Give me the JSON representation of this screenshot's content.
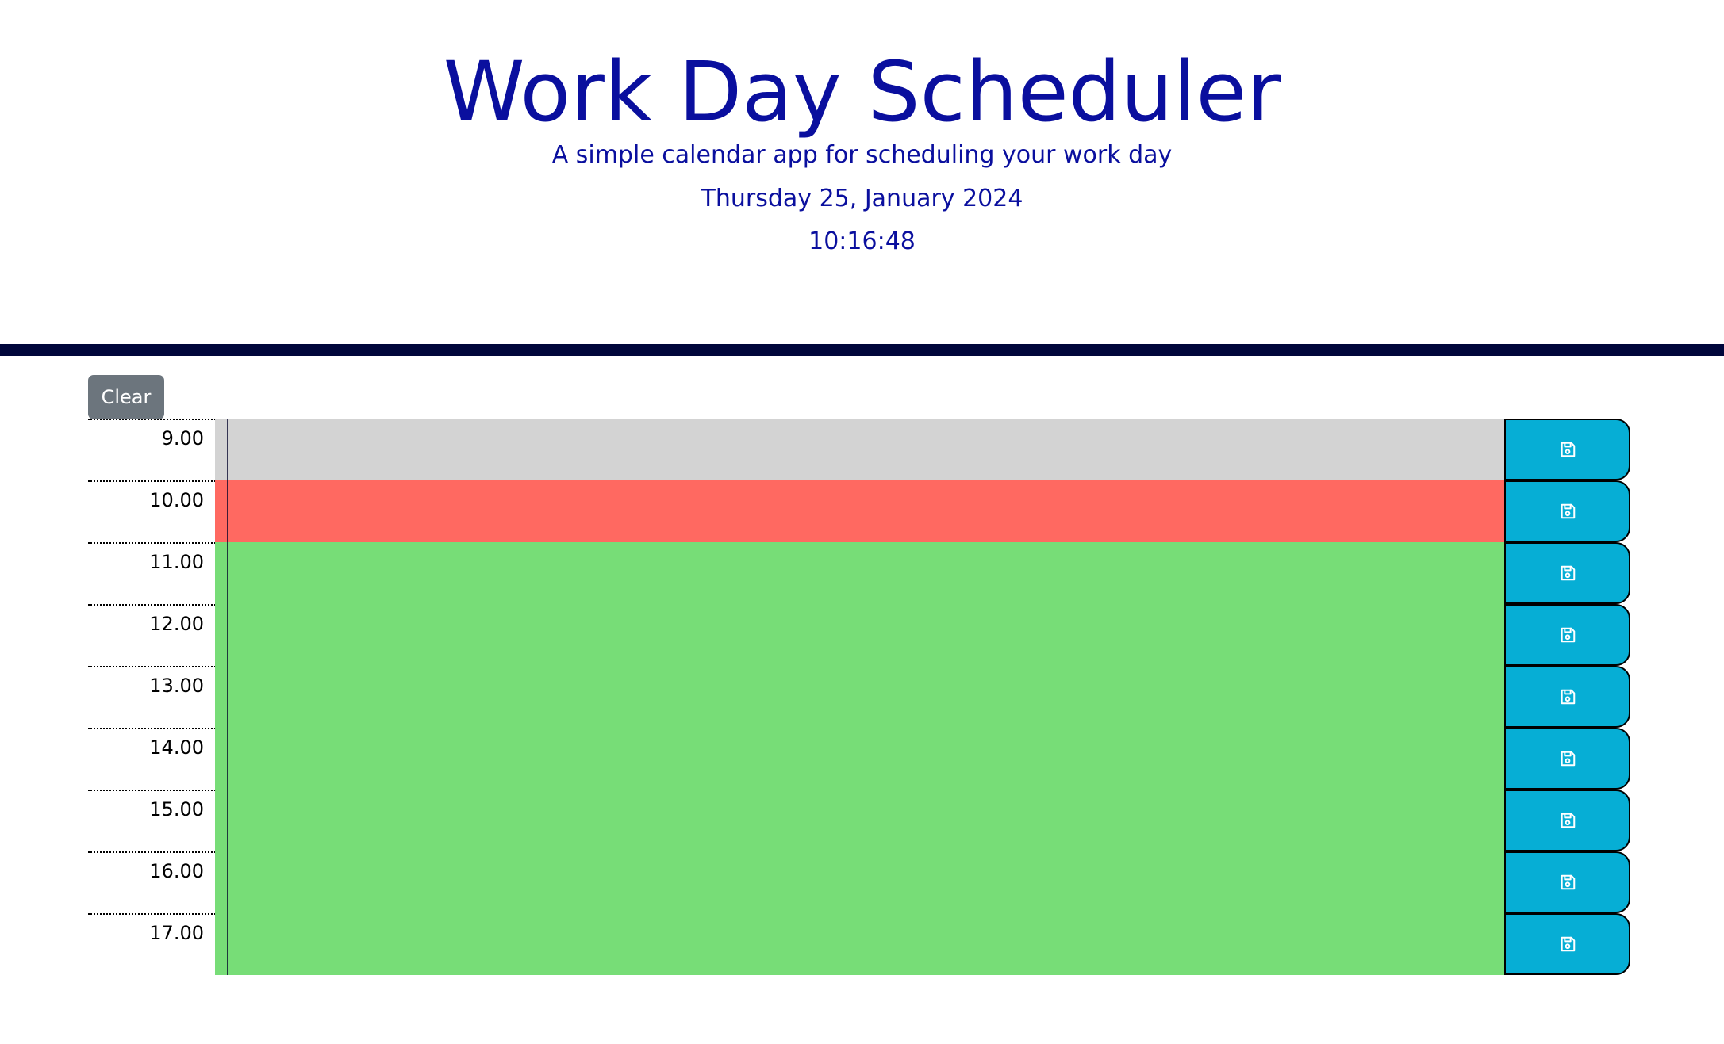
{
  "header": {
    "title": "Work Day Scheduler",
    "subtitle": "A simple calendar app for scheduling your work day",
    "date": "Thursday 25, January 2024",
    "time": "10:16:48"
  },
  "colors": {
    "past": "#d3d3d3",
    "present": "#ff6961",
    "future": "#77dd77",
    "save_button": "#06aed5",
    "clear_button": "#6c757d",
    "header_text": "#0a0f9e",
    "divider": "#00063b"
  },
  "controls": {
    "clear_label": "Clear",
    "save_icon": "floppy-disk-icon"
  },
  "schedule": {
    "rows": [
      {
        "hour": "9.00",
        "status": "past",
        "text": ""
      },
      {
        "hour": "10.00",
        "status": "present",
        "text": ""
      },
      {
        "hour": "11.00",
        "status": "future",
        "text": ""
      },
      {
        "hour": "12.00",
        "status": "future",
        "text": ""
      },
      {
        "hour": "13.00",
        "status": "future",
        "text": ""
      },
      {
        "hour": "14.00",
        "status": "future",
        "text": ""
      },
      {
        "hour": "15.00",
        "status": "future",
        "text": ""
      },
      {
        "hour": "16.00",
        "status": "future",
        "text": ""
      },
      {
        "hour": "17.00",
        "status": "future",
        "text": ""
      }
    ]
  }
}
